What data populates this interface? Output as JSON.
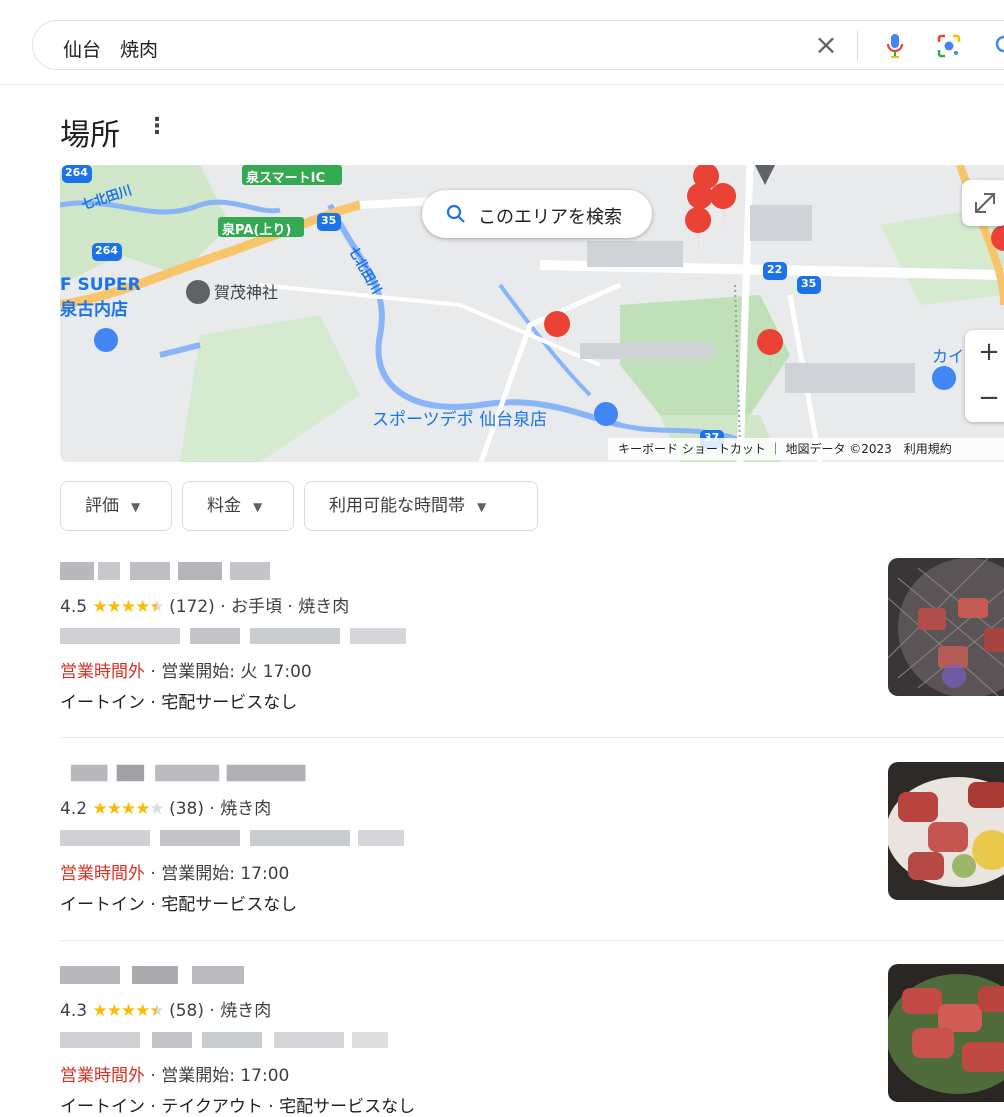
{
  "search": {
    "query": "仙台　焼肉"
  },
  "places": {
    "title": "場所",
    "more": "⋮"
  },
  "map": {
    "search_area": "このエリアを検索",
    "attribution": "キーボード ショートカット ｜ 地図データ ©2023　利用規約",
    "labels": {
      "smart_ic": "泉スマートIC",
      "pa": "泉PA(上り)",
      "super": "F SUPER",
      "super2": "泉古内店",
      "shrine": "賀茂神社",
      "river1": "七北田川",
      "river2": "七北田川",
      "sports": "スポーツデポ 仙台泉店",
      "kain": "カイン",
      "r264a": "264",
      "r264b": "264",
      "r35a": "35",
      "r35b": "35",
      "r22": "22",
      "r37": "37"
    }
  },
  "filters": [
    {
      "label": "評価"
    },
    {
      "label": "料金"
    },
    {
      "label": "利用可能な時間帯"
    }
  ],
  "results": [
    {
      "rating": "4.5",
      "reviews": "(172)",
      "meta": "· お手頃 · 焼き肉",
      "status": "営業時間外",
      "hours": " · 営業開始: 火 17:00",
      "services": "イートイン · 宅配サービスなし",
      "stars": 4.5
    },
    {
      "rating": "4.2",
      "reviews": "(38)",
      "meta": "· 焼き肉",
      "status": "営業時間外",
      "hours": " · 営業開始: 17:00",
      "services": "イートイン · 宅配サービスなし",
      "stars": 4
    },
    {
      "rating": "4.3",
      "reviews": "(58)",
      "meta": "· 焼き肉",
      "status": "営業時間外",
      "hours": " · 営業開始: 17:00",
      "services": "イートイン · テイクアウト · 宅配サービスなし",
      "stars": 4.5
    }
  ],
  "colors": {
    "closed": "#d93025",
    "star": "#fbbc04",
    "pin": "#ea4335",
    "accent": "#1a73e8"
  }
}
